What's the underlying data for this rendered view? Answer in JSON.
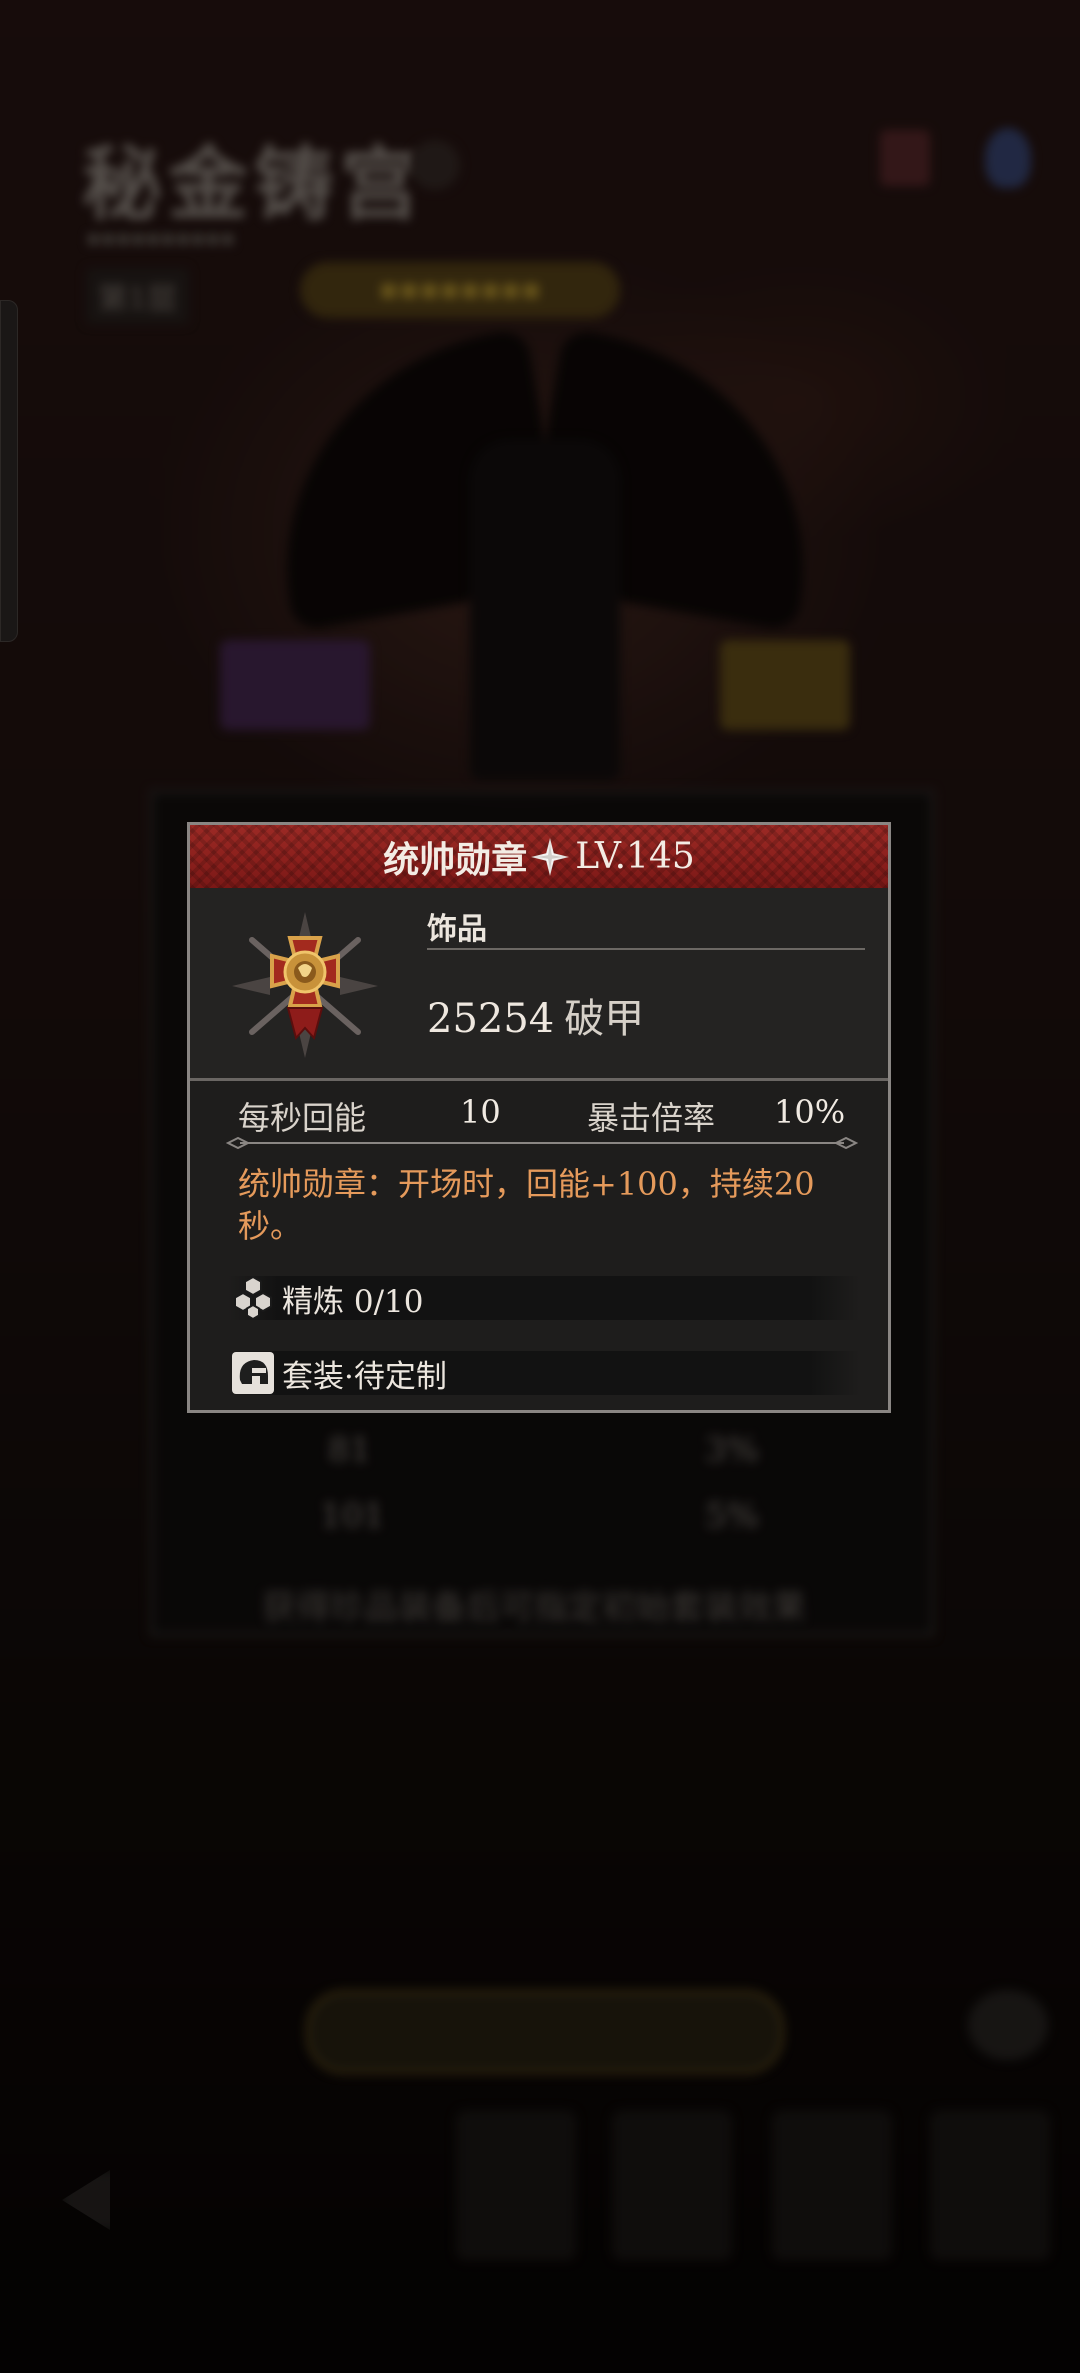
{
  "item": {
    "name": "统帅勋章",
    "level": "LV.145",
    "category": "饰品",
    "power_value": "25254",
    "power_label": "破甲",
    "stats": [
      {
        "label": "每秒回能",
        "value": "10"
      },
      {
        "label": "暴击倍率",
        "value": "10%"
      }
    ],
    "description": "统帅勋章：开场时，回能+100，持续20秒。",
    "refine": "精炼 0/10",
    "set": "套装·待定制"
  },
  "icons": {
    "star": "four-point-star-icon",
    "medal": "medal-item-icon",
    "refine": "hexagon-cluster-icon",
    "set": "helmet-icon"
  },
  "colors": {
    "header_red": "#8a1f1c",
    "description_orange": "#e59a5b",
    "card_bg": "#1e1d1c",
    "border": "#8a8683"
  }
}
